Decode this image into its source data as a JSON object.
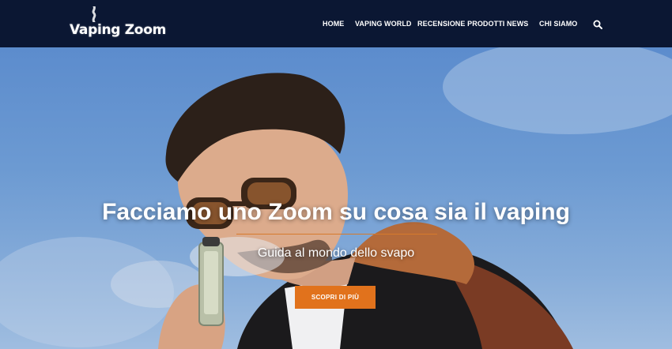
{
  "brand": {
    "logo_text": "Vaping Zoom"
  },
  "nav": {
    "items": [
      {
        "label": "HOME"
      },
      {
        "label": "VAPING WORLD"
      },
      {
        "label": "RECENSIONE PRODOTTI"
      },
      {
        "label": "NEWS"
      },
      {
        "label": "CHI SIAMO"
      }
    ],
    "search_icon": "search-icon"
  },
  "hero": {
    "headline": "Facciamo uno Zoom su cosa sia il vaping",
    "subheadline": "Guida al mondo dello svapo",
    "cta_label": "SCOPRI DI PIÙ"
  },
  "colors": {
    "header_bg": "#0b1733",
    "accent": "#e1721c",
    "sky": "#6c9ad2"
  }
}
